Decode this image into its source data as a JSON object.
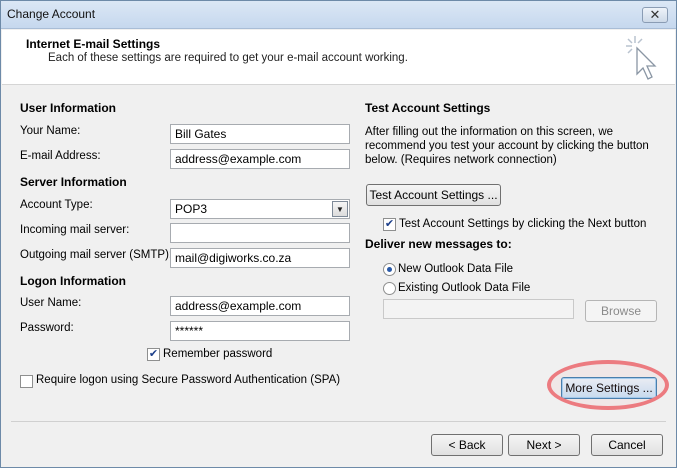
{
  "window": {
    "title": "Change Account",
    "close_glyph": "✕"
  },
  "header": {
    "title": "Internet E-mail Settings",
    "subtitle": "Each of these settings are required to get your e-mail account working.",
    "icon": "cursor-click-icon"
  },
  "user_info": {
    "section": "User Information",
    "name_label": "Your Name:",
    "name_value": "Bill Gates",
    "email_label": "E-mail Address:",
    "email_value": "address@example.com"
  },
  "server_info": {
    "section": "Server Information",
    "account_type_label": "Account Type:",
    "account_type_value": "POP3",
    "incoming_label": "Incoming mail server:",
    "incoming_value": "",
    "outgoing_label": "Outgoing mail server (SMTP):",
    "outgoing_value": "mail@digiworks.co.za"
  },
  "logon_info": {
    "section": "Logon Information",
    "username_label": "User Name:",
    "username_value": "address@example.com",
    "password_label": "Password:",
    "password_value": "******",
    "remember_label": "Remember password",
    "remember_checked": true,
    "spa_label": "Require logon using Secure Password Authentication (SPA)",
    "spa_checked": false
  },
  "test_settings": {
    "section": "Test Account Settings",
    "description": "After filling out the information on this screen, we recommend you test your account by clicking the button below. (Requires network connection)",
    "test_button": "Test Account Settings ...",
    "auto_test_label": "Test Account Settings by clicking the Next button",
    "auto_test_checked": true
  },
  "deliver": {
    "section": "Deliver new messages to:",
    "option_new": "New Outlook Data File",
    "option_existing": "Existing Outlook Data File",
    "selected": "new",
    "browse_button": "Browse"
  },
  "more_settings_button": "More Settings ...",
  "footer": {
    "back": "< Back",
    "next": "Next >",
    "cancel": "Cancel"
  },
  "colors": {
    "highlight": "#ec7b80",
    "titlebar": "#c6d8ee"
  }
}
